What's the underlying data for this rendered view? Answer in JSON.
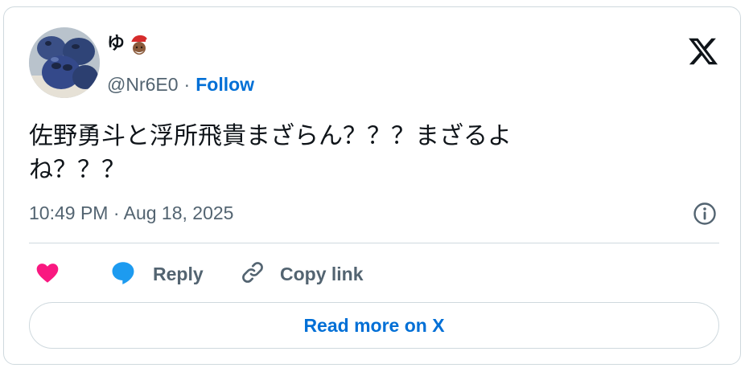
{
  "author": {
    "display_name": "ゆ",
    "handle": "@Nr6E0",
    "separator": "·",
    "follow_label": "Follow"
  },
  "tweet": {
    "text": "佐野勇斗と浮所飛貴まざらん？？？まざるよ\nね？？？",
    "timestamp": "10:49 PM · Aug 18, 2025"
  },
  "actions": {
    "like_icon": "heart-icon",
    "reply_label": "Reply",
    "copy_link_label": "Copy link"
  },
  "footer": {
    "read_more_label": "Read more on X"
  },
  "colors": {
    "link_blue": "#006fd6",
    "secondary_text": "#536471",
    "like_pink": "#f91880",
    "reply_blue": "#1d9bf0",
    "border": "#cfd9de"
  }
}
